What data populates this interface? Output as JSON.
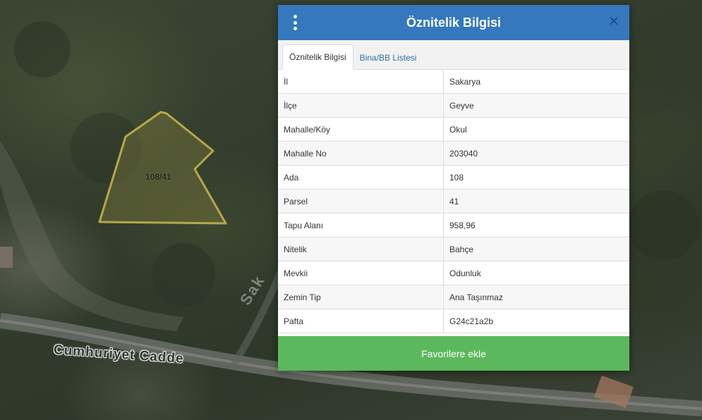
{
  "map": {
    "parcel_label": "108/41",
    "street_label": "Cumhuriyet Cadde",
    "street_label_2": "Sak"
  },
  "panel": {
    "title": "Öznitelik Bilgisi",
    "menu_icon": "vertical-dots-icon",
    "close_icon": "close-icon",
    "tabs": [
      {
        "label": "Öznitelik Bilgisi",
        "active": true
      },
      {
        "label": "Bina/BB Listesi",
        "active": false
      }
    ],
    "rows": [
      {
        "key": "İl",
        "value": "Sakarya"
      },
      {
        "key": "İlçe",
        "value": "Geyve"
      },
      {
        "key": "Mahalle/Köy",
        "value": "Okul"
      },
      {
        "key": "Mahalle No",
        "value": "203040"
      },
      {
        "key": "Ada",
        "value": "108"
      },
      {
        "key": "Parsel",
        "value": "41"
      },
      {
        "key": "Tapu Alanı",
        "value": "958,96"
      },
      {
        "key": "Nitelik",
        "value": "Bahçe"
      },
      {
        "key": "Mevkii",
        "value": "Odunluk"
      },
      {
        "key": "Zemin Tip",
        "value": "Ana Taşınmaz"
      },
      {
        "key": "Pafta",
        "value": "G24c21a2b"
      }
    ],
    "favorite_button": "Favorilere ekle"
  },
  "colors": {
    "header": "#3578bd",
    "button": "#5cb85c",
    "parcel_outline": "#b5a848"
  }
}
